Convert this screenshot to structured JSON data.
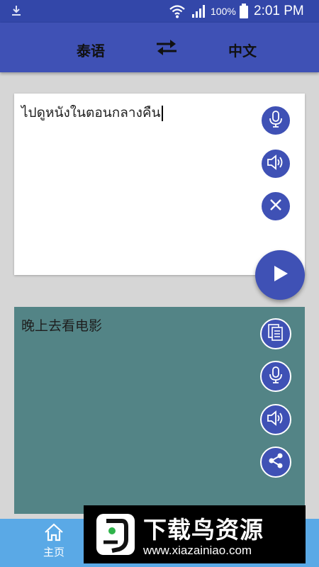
{
  "status_bar": {
    "battery_percent": "100%",
    "time": "2:01 PM",
    "icons": [
      "download-icon",
      "wifi-icon",
      "signal-icon",
      "battery-icon"
    ]
  },
  "header": {
    "source_language": "泰语",
    "target_language": "中文",
    "swap_icon": "swap-arrows-icon"
  },
  "input_panel": {
    "text": "ไปดูหนังในตอนกลางคืน",
    "buttons": [
      "microphone-icon",
      "speaker-icon",
      "clear-icon"
    ]
  },
  "translate_button": {
    "icon": "play-icon"
  },
  "output_panel": {
    "text": "晚上去看电影",
    "buttons": [
      "copy-icon",
      "microphone-icon",
      "speaker-icon",
      "share-icon"
    ]
  },
  "bottom_nav": {
    "home_label": "主页",
    "home_icon": "home-icon"
  },
  "watermark": {
    "title": "下载鸟资源",
    "url": "www.xiazainiao.com"
  },
  "colors": {
    "primary": "#3f51b5",
    "status_bar": "#3347a9",
    "output_bg": "#538486",
    "nav_bg": "#5aa9e6"
  }
}
